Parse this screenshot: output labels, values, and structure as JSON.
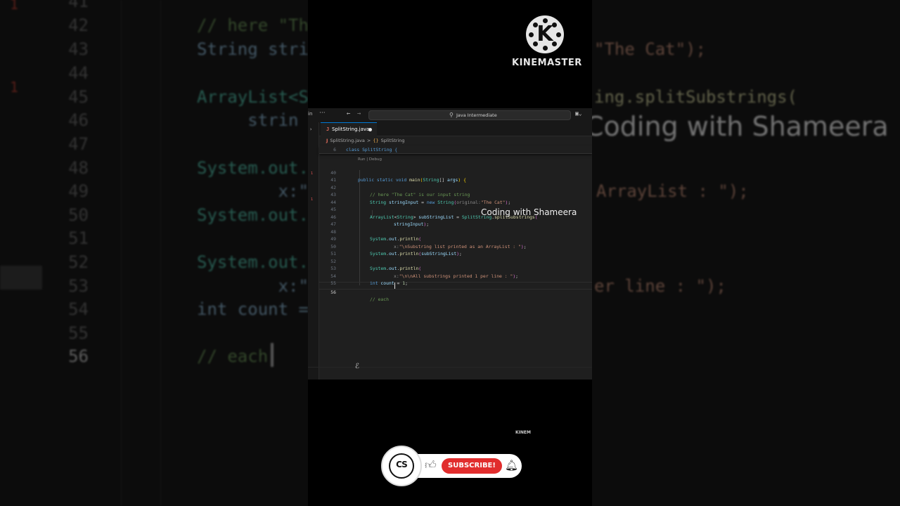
{
  "app": {
    "search_text": "Java Intermediate",
    "menu_fragment": "in",
    "more_glyph": "···"
  },
  "branding": {
    "logo_letter": "K",
    "logo_name": "KINEMASTER",
    "small_logo": "KINEM",
    "overlay_channel": "Coding with Shameera"
  },
  "editor": {
    "tab": {
      "icon": "J",
      "label": "SplitString.java",
      "modified": true
    },
    "breadcrumb": {
      "file_icon": "J",
      "file": "SplitString.java",
      "separator": ">",
      "class_icon": "{}",
      "class": "SplitString"
    },
    "sticky_line": {
      "number": "6",
      "text": "class SplitString {"
    },
    "codelens": "Run | Debug",
    "lines": [
      {
        "n": "40",
        "text": "public static void main(String[] args) {"
      },
      {
        "n": "41",
        "text": ""
      },
      {
        "n": "42",
        "text": "// here \"The Cat\" is our input string"
      },
      {
        "n": "43",
        "text": "String stringInput = new String(original:\"The Cat\");"
      },
      {
        "n": "44",
        "text": ""
      },
      {
        "n": "45",
        "text": "ArrayList<String> subStringList = SplitString.splitSubstrings("
      },
      {
        "n": "46",
        "text": "stringInput);"
      },
      {
        "n": "47",
        "text": ""
      },
      {
        "n": "48",
        "text": "System.out.println("
      },
      {
        "n": "49",
        "text": "x:\"\\nSubstring list printed as an ArrayList : \");"
      },
      {
        "n": "50",
        "text": "System.out.println(subStringList);"
      },
      {
        "n": "51",
        "text": ""
      },
      {
        "n": "52",
        "text": "System.out.println("
      },
      {
        "n": "53",
        "text": "x:\"\\n\\nAll substrings printed 1 per line : \");"
      },
      {
        "n": "54",
        "text": "int count = 1;"
      },
      {
        "n": "55",
        "text": ""
      },
      {
        "n": "56",
        "text": "// each"
      }
    ],
    "current_line": "56",
    "gutter_markers": [
      "1",
      "1"
    ]
  },
  "background": {
    "line_numbers": [
      "41",
      "42",
      "43",
      "44",
      "45",
      "46",
      "47",
      "48",
      "49",
      "50",
      "51",
      "52",
      "53",
      "54",
      "55",
      "56"
    ],
    "code": {
      "l42": "// here \"The",
      "l43": "String strin",
      "l45": "ArrayList<St",
      "l46": "     strin",
      "l48": "System.out.p",
      "l49": "        x:\"\\",
      "l50": "System.out.p",
      "l52": "System.out.p",
      "l53": "        x:\"\\",
      "l54": "int count =",
      "l56": "// each"
    },
    "right": {
      "r43": "\"The Cat\");",
      "r45": "ing.splitSubstrings(",
      "r49": "ArrayList : \");",
      "r53": "er line : \");"
    }
  },
  "badges": {
    "channel_initials": "CS",
    "subscribe": "SUBSCRIBE!"
  },
  "colors": {
    "subscribe_red": "#e12d2d",
    "editor_bg": "#1f1f1f",
    "accent_blue": "#0078d4"
  }
}
